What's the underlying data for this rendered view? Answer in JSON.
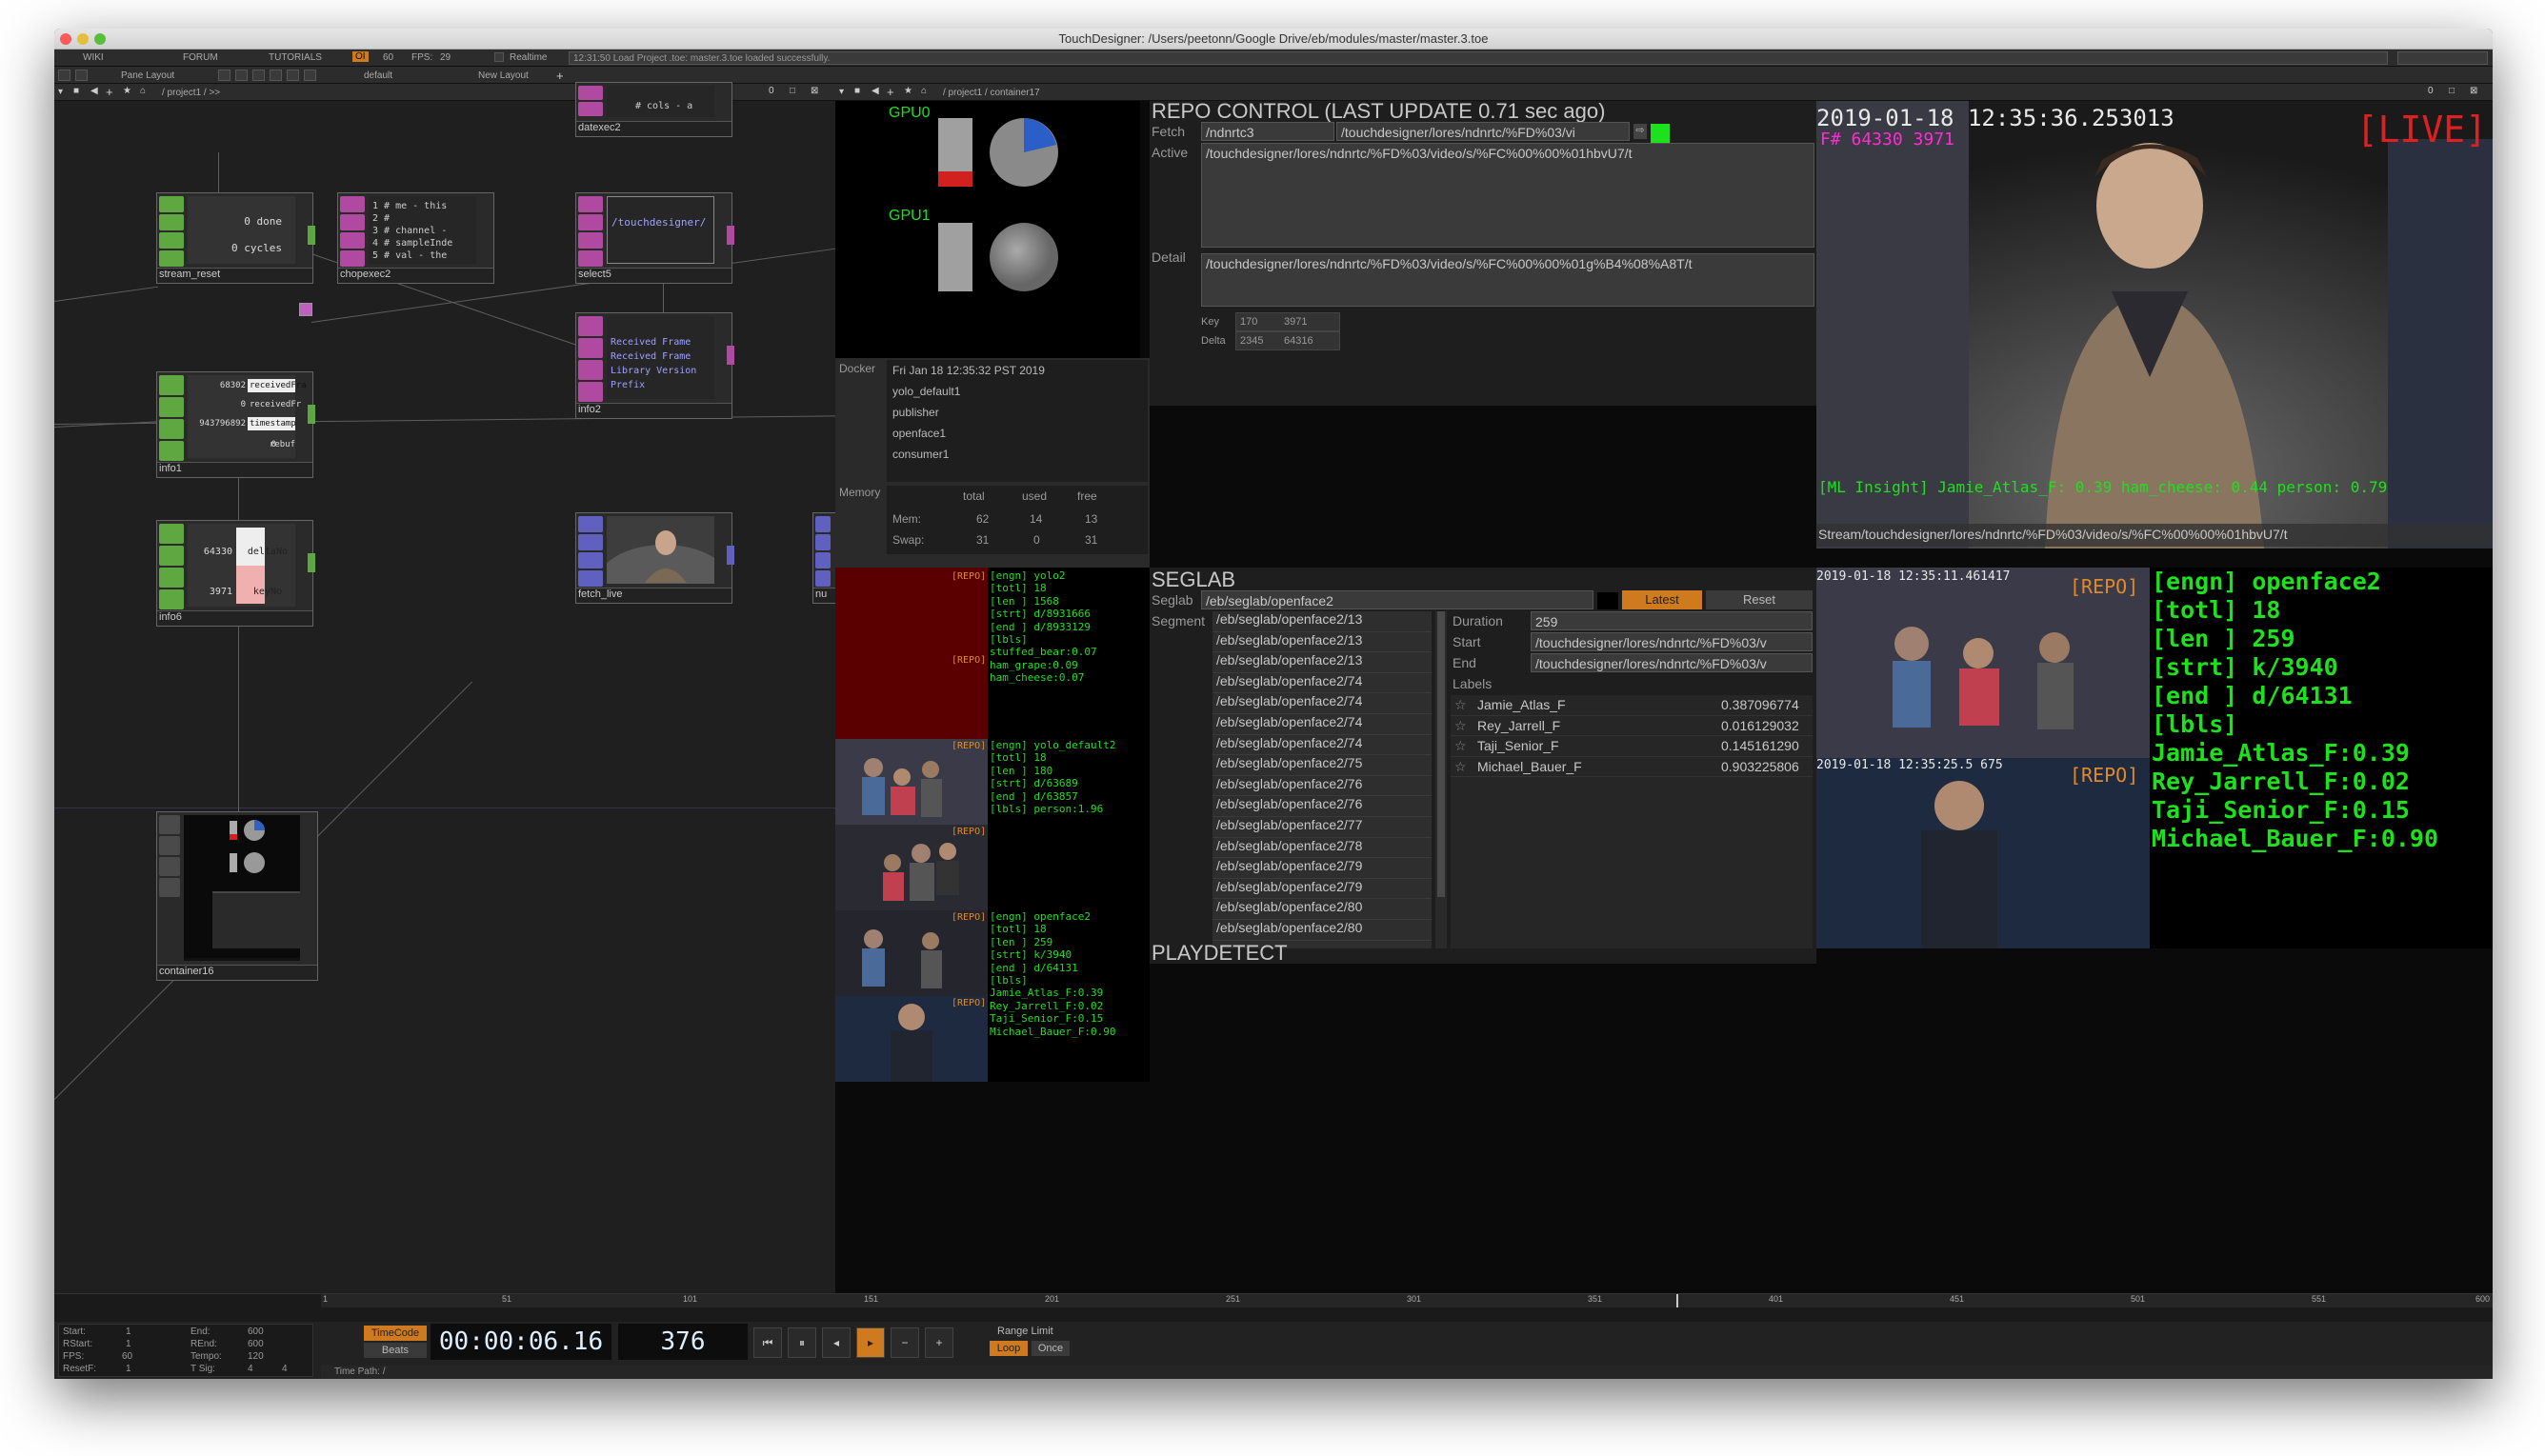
{
  "window": {
    "title": "TouchDesigner: /Users/peetonn/Google Drive/eb/modules/master/master.3.toe"
  },
  "menubar": {
    "wiki": "WIKI",
    "forum": "FORUM",
    "tutorials": "TUTORIALS",
    "oi": "OI",
    "sixty": "60",
    "fps_label": "FPS:",
    "fps_value": "29",
    "realtime": "Realtime",
    "status": "12:31:50 Load Project .toe: master.3.toe loaded successfully."
  },
  "toolbar2": {
    "pane_layout": "Pane Layout",
    "default": "default",
    "new_layout": "New Layout"
  },
  "pane_left": {
    "path": "/ project1 / >>"
  },
  "pane_right": {
    "path": "/ project1 / container17"
  },
  "nodes": {
    "stream_reset": {
      "name": "stream_reset",
      "l1": "0 done",
      "l2": "0 cycles"
    },
    "chopexec2": {
      "name": "chopexec2",
      "lines": [
        "1  # me - this",
        "2  #",
        "3  # channel -",
        "4  # sampleInde",
        "5  # val - the"
      ]
    },
    "datexec2": {
      "name": "datexec2",
      "line": "# cols - a"
    },
    "select5": {
      "name": "select5",
      "line": "/touchdesigner/"
    },
    "info2": {
      "name": "info2",
      "lines": [
        "Received Frame",
        "Received Frame",
        "Library Version",
        "Prefix"
      ]
    },
    "info1": {
      "name": "info1",
      "rows": [
        [
          "68302",
          "receivedFra"
        ],
        [
          "0",
          "receivedFr"
        ],
        [
          "943796892",
          "timestamp"
        ],
        [
          "0",
          "rebuf"
        ]
      ]
    },
    "info6": {
      "name": "info6",
      "rows": [
        [
          "64330",
          "deltaNo"
        ],
        [
          "3971",
          "keyNo"
        ]
      ]
    },
    "fetch_live": {
      "name": "fetch_live"
    },
    "nu": {
      "name": "nu"
    },
    "container16": {
      "name": "container16"
    }
  },
  "gpu": {
    "gpu0": "GPU0",
    "gpu1": "GPU1"
  },
  "docker": {
    "label": "Docker",
    "date": "Fri Jan 18 12:35:32 PST 2019",
    "items": [
      "yolo_default1",
      "publisher",
      "openface1",
      "consumer1"
    ]
  },
  "memory": {
    "label": "Memory",
    "headers": [
      "total",
      "used",
      "free"
    ],
    "rows": [
      [
        "Mem:",
        "62",
        "14",
        "13"
      ],
      [
        "Swap:",
        "31",
        "0",
        "31"
      ]
    ]
  },
  "repo": {
    "title": "REPO CONTROL (LAST UPDATE 0.71 sec ago)",
    "fetch_label": "Fetch",
    "fetch_value": "/ndnrtc3",
    "fetch_path": "/touchdesigner/lores/ndnrtc/%FD%03/vi",
    "active_label": "Active",
    "active_value": "/touchdesigner/lores/ndnrtc/%FD%03/video/s/%FC%00%00%01hbvU7/t",
    "detail_label": "Detail",
    "detail_value": "/touchdesigner/lores/ndnrtc/%FD%03/video/s/%FC%00%00%01g%B4%08%A8T/t",
    "key_label": "Key",
    "key_a": "170",
    "key_b": "3971",
    "delta_label": "Delta",
    "delta_a": "2345",
    "delta_b": "64316"
  },
  "live": {
    "timestamp": "2019-01-18 12:35:36.253013",
    "frame": "F# 64330 3971",
    "badge": "[LIVE]",
    "insight": "[ML Insight] Jamie_Atlas_F: 0.39 ham_cheese: 0.44 person: 0.79",
    "stream": "Stream/touchdesigner/lores/ndnrtc/%FD%03/video/s/%FC%00%00%01hbvU7/t"
  },
  "seglab": {
    "title": "SEGLAB",
    "seglab_label": "Seglab",
    "seglab_value": "/eb/seglab/openface2",
    "latest": "Latest",
    "reset": "Reset",
    "segment_label": "Segment",
    "segments": [
      "/eb/seglab/openface2/13",
      "/eb/seglab/openface2/13",
      "/eb/seglab/openface2/13",
      "/eb/seglab/openface2/74",
      "/eb/seglab/openface2/74",
      "/eb/seglab/openface2/74",
      "/eb/seglab/openface2/74",
      "/eb/seglab/openface2/75",
      "/eb/seglab/openface2/76",
      "/eb/seglab/openface2/76",
      "/eb/seglab/openface2/77",
      "/eb/seglab/openface2/78",
      "/eb/seglab/openface2/79",
      "/eb/seglab/openface2/79",
      "/eb/seglab/openface2/80",
      "/eb/seglab/openface2/80"
    ],
    "duration_label": "Duration",
    "duration_value": "259",
    "start_label": "Start",
    "start_value": "/touchdesigner/lores/ndnrtc/%FD%03/v",
    "end_label": "End",
    "end_value": "/touchdesigner/lores/ndnrtc/%FD%03/v",
    "labels_label": "Labels",
    "labels": [
      [
        "Jamie_Atlas_F",
        "0.387096774"
      ],
      [
        "Rey_Jarrell_F",
        "0.016129032"
      ],
      [
        "Taji_Senior_F",
        "0.145161290"
      ],
      [
        "Michael_Bauer_F",
        "0.903225806"
      ]
    ]
  },
  "playdetect": {
    "title": "PLAYDETECT"
  },
  "detect_left": {
    "repo": "[REPO]",
    "yolo2": [
      "[engn] yolo2",
      "[totl] 18",
      "[len ] 1568",
      "[strt] d/8931666",
      "[end ] d/8933129",
      "[lbls]",
      "stuffed_bear:0.07",
      "ham_grape:0.09",
      "ham_cheese:0.07"
    ],
    "yolo_default2": [
      "[engn] yolo_default2",
      "[totl] 18",
      "[len ] 180",
      "[strt] d/63689",
      "[end ] d/63857",
      "[lbls] person:1.96"
    ],
    "openface2": [
      "[engn] openface2",
      "[totl] 18",
      "[len ] 259",
      "[strt] k/3940",
      "[end ] d/64131",
      "[lbls]",
      "Jamie_Atlas_F:0.39",
      "Rey_Jarrell_F:0.02",
      "Taji_Senior_F:0.15",
      "Michael_Bauer_F:0.90"
    ]
  },
  "repo_right": {
    "ts1": "2019-01-18 12:35:11.461417",
    "ts2": "2019-01-18 12:35:25.5 675",
    "repo": "[REPO]",
    "lines": [
      "[engn] openface2",
      "[totl] 18",
      "[len ] 259",
      "[strt] k/3940",
      "[end ] d/64131",
      "[lbls]",
      "Jamie_Atlas_F:0.39",
      "Rey_Jarrell_F:0.02",
      "Taji_Senior_F:0.15",
      "Michael_Bauer_F:0.90"
    ]
  },
  "timeline": {
    "ticks": [
      "1",
      "51",
      "101",
      "151",
      "201",
      "251",
      "301",
      "351",
      "401",
      "451",
      "501",
      "551",
      "600"
    ],
    "timecode": "00:00:06.16",
    "frame": "376",
    "timecode_btn": "TimeCode",
    "beats_btn": "Beats",
    "range_limit": "Range Limit",
    "loop": "Loop",
    "once": "Once",
    "time_path": "Time Path: /"
  },
  "stats": {
    "start_l": "Start:",
    "start_v": "1",
    "rstart_l": "RStart:",
    "rstart_v": "1",
    "fps_l": "FPS:",
    "fps_v": "60",
    "resetf_l": "ResetF:",
    "resetf_v": "1",
    "end_l": "End:",
    "end_v": "600",
    "rend_l": "REnd:",
    "rend_v": "600",
    "tempo_l": "Tempo:",
    "tempo_v": "120",
    "tsig_l": "T Sig:",
    "tsig_a": "4",
    "tsig_b": "4"
  },
  "colors": {
    "green": "#1ee11e",
    "orange": "#e08a2a",
    "live_red": "#e02020",
    "magenta": "#ff2bd6"
  }
}
